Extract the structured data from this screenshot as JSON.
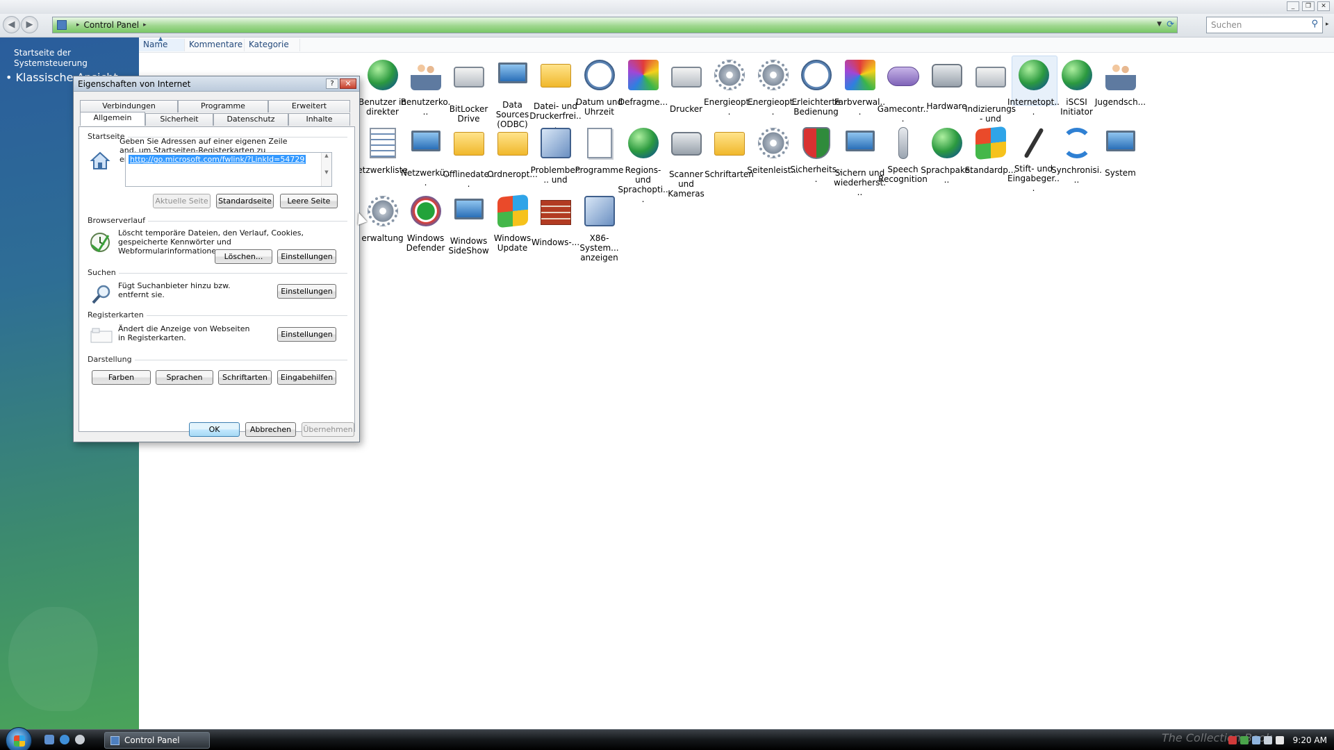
{
  "window": {
    "controls": [
      "minimize",
      "restore",
      "close"
    ]
  },
  "address_bar": {
    "breadcrumb": [
      "Control Panel"
    ],
    "search_placeholder": "Suchen"
  },
  "sidebar": {
    "home_link": "Startseite der Systemsteuerung",
    "classic_view": "Klassische Ansicht"
  },
  "columns": [
    "Name",
    "Kommentare",
    "Kategorie"
  ],
  "items": [
    {
      "label": "Benutzer in direkter",
      "icon": "user-globe-icon",
      "shape": "globe"
    },
    {
      "label": "Benutzerko...",
      "icon": "user-accounts-icon",
      "shape": "people"
    },
    {
      "label": "BitLocker Drive",
      "icon": "bitlocker-icon",
      "shape": "printer"
    },
    {
      "label": "Data Sources (ODBC)",
      "icon": "data-sources-icon",
      "shape": "monitor"
    },
    {
      "label": "Datei- und Druckerfrei...",
      "icon": "file-sharing-icon",
      "shape": "folder"
    },
    {
      "label": "Datum und Uhrzeit",
      "icon": "date-time-icon",
      "shape": "clock"
    },
    {
      "label": "Defragme...",
      "icon": "defrag-icon",
      "shape": "color"
    },
    {
      "label": "Drucker",
      "icon": "printer-icon",
      "shape": "printer"
    },
    {
      "label": "Energieopt...",
      "icon": "power-options-icon",
      "shape": "gear"
    },
    {
      "label": "Energieopt...",
      "icon": "power-options-icon",
      "shape": "gear"
    },
    {
      "label": "Erleichterte Bedienung",
      "icon": "ease-of-access-icon",
      "shape": "clock"
    },
    {
      "label": "Farbverwal...",
      "icon": "color-management-icon",
      "shape": "color"
    },
    {
      "label": "Gamecontr...",
      "icon": "game-controller-icon",
      "shape": "pad"
    },
    {
      "label": "Hardware",
      "icon": "hardware-icon",
      "shape": "camera"
    },
    {
      "label": "Indizierungs- und",
      "icon": "indexing-icon",
      "shape": "printer"
    },
    {
      "label": "Internetopt...",
      "icon": "internet-options-icon",
      "shape": "globe",
      "selected": true
    },
    {
      "label": "iSCSI Initiator",
      "icon": "iscsi-icon",
      "shape": "globe"
    },
    {
      "label": "Jugendsch...",
      "icon": "parental-controls-icon",
      "shape": "people"
    },
    {
      "label": "etzwerkliste",
      "icon": "network-list-icon",
      "shape": "list"
    },
    {
      "label": "Netzwerkü...",
      "icon": "network-icon",
      "shape": "monitor"
    },
    {
      "label": "Offlinedate...",
      "icon": "offline-files-icon",
      "shape": "folder"
    },
    {
      "label": "Ordneropt...",
      "icon": "folder-options-icon",
      "shape": "folder"
    },
    {
      "label": "Problember... und",
      "icon": "problem-reports-icon",
      "shape": "check"
    },
    {
      "label": "Programme",
      "icon": "programs-icon",
      "shape": "doc"
    },
    {
      "label": "Regions- und Sprachopti...",
      "icon": "regional-icon",
      "shape": "globe"
    },
    {
      "label": "Scanner und Kameras",
      "icon": "scanner-icon",
      "shape": "camera"
    },
    {
      "label": "Schriftarten",
      "icon": "fonts-icon",
      "shape": "folder"
    },
    {
      "label": "Seitenleist...",
      "icon": "sidebar-icon",
      "shape": "gear"
    },
    {
      "label": "Sicherheits...",
      "icon": "security-center-icon",
      "shape": "shield"
    },
    {
      "label": "Sichern und wiederherst...",
      "icon": "backup-icon",
      "shape": "monitor"
    },
    {
      "label": "Speech Recognition",
      "icon": "microphone-icon",
      "shape": "mic"
    },
    {
      "label": "Sprachpake...",
      "icon": "language-pack-icon",
      "shape": "globe"
    },
    {
      "label": "Standardp...",
      "icon": "default-programs-icon",
      "shape": "windows"
    },
    {
      "label": "Stift- und Eingabeger...",
      "icon": "pen-input-icon",
      "shape": "pen"
    },
    {
      "label": "Synchronisi...",
      "icon": "sync-center-icon",
      "shape": "sync"
    },
    {
      "label": "System",
      "icon": "system-icon",
      "shape": "monitor"
    },
    {
      "label": "erwaltung",
      "icon": "admin-tools-icon",
      "shape": "gear"
    },
    {
      "label": "Windows Defender",
      "icon": "windows-defender-icon",
      "shape": "defender"
    },
    {
      "label": "Windows SideShow",
      "icon": "sideshow-icon",
      "shape": "monitor"
    },
    {
      "label": "Windows Update",
      "icon": "windows-update-icon",
      "shape": "windows"
    },
    {
      "label": "Windows-...",
      "icon": "firewall-icon",
      "shape": "wall"
    },
    {
      "label": "X86-System... anzeigen",
      "icon": "x86-system-icon",
      "shape": "check"
    }
  ],
  "dialog": {
    "title": "Eigenschaften von Internet",
    "help": "?",
    "close": "✕",
    "tabs_top": [
      "Verbindungen",
      "Programme",
      "Erweitert"
    ],
    "tabs_bottom": [
      "Allgemein",
      "Sicherheit",
      "Datenschutz",
      "Inhalte"
    ],
    "active_tab": "Allgemein",
    "startseite": {
      "label": "Startseite",
      "desc": "Geben Sie Adressen auf einer eigenen Zeile and, um Startseiten-Registerkarten zu erstellen.",
      "url": "http://go.microsoft.com/fwlink/?LinkId=54729",
      "btn_current": "Aktuelle Seite",
      "btn_default": "Standardseite",
      "btn_blank": "Leere Seite"
    },
    "verlauf": {
      "label": "Browserverlauf",
      "desc": "Löscht temporäre Dateien, den Verlauf, Cookies, gespeicherte Kennwörter und Webformularinformationen.",
      "btn_delete": "Löschen...",
      "btn_settings": "Einstellungen"
    },
    "suchen": {
      "label": "Suchen",
      "desc": "Fügt Suchanbieter hinzu bzw. entfernt sie.",
      "btn_settings": "Einstellungen"
    },
    "register": {
      "label": "Registerkarten",
      "desc": "Ändert die Anzeige von Webseiten in Registerkarten.",
      "btn_settings": "Einstellungen"
    },
    "darstellung": {
      "label": "Darstellung",
      "btn_colors": "Farben",
      "btn_languages": "Sprachen",
      "btn_fonts": "Schriftarten",
      "btn_access": "Eingabehilfen"
    },
    "ok": "OK",
    "cancel": "Abbrechen",
    "apply": "Übernehmen"
  },
  "taskbar": {
    "task_label": "Control Panel",
    "watermark": "The Collection Book",
    "clock": "9:20 AM"
  }
}
